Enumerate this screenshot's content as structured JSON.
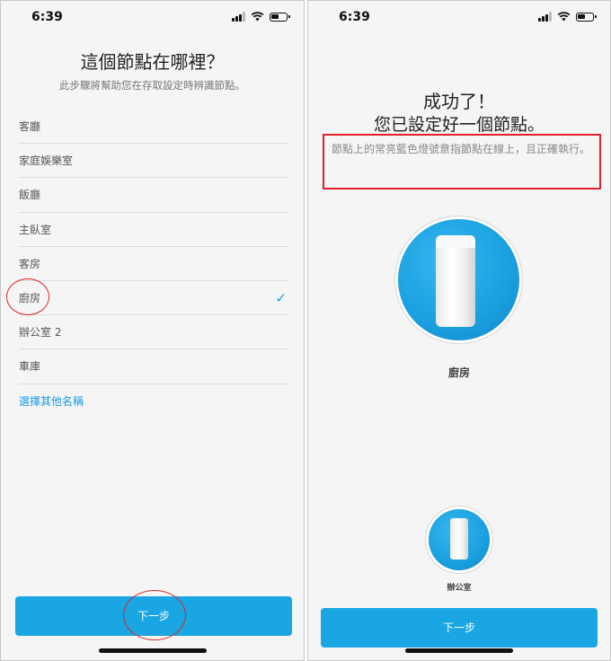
{
  "left_screen": {
    "time": "6:39",
    "title": "這個節點在哪裡？",
    "subtitle": "此步驟將幫助您在存取設定時辨識節點。",
    "rooms": [
      {
        "label": "客廳",
        "selected": false
      },
      {
        "label": "家庭娛樂室",
        "selected": false
      },
      {
        "label": "飯廳",
        "selected": false
      },
      {
        "label": "主臥室",
        "selected": false
      },
      {
        "label": "客房",
        "selected": false
      },
      {
        "label": "廚房",
        "selected": true
      },
      {
        "label": "辦公室 2",
        "selected": false
      },
      {
        "label": "車庫",
        "selected": false
      }
    ],
    "check_icon": "✓",
    "other_name_link": "選擇其他名稱",
    "next_button": "下一步"
  },
  "right_screen": {
    "time": "6:39",
    "title_line1": "成功了！",
    "title_line2": "您已設定好一個節點。",
    "info_text": "節點上的常亮藍色燈號意指節點在線上，且正確執行。",
    "nodes": [
      {
        "label": "廚房",
        "size": "large"
      },
      {
        "label": "辦公室",
        "size": "small"
      }
    ],
    "next_button": "下一步"
  },
  "colors": {
    "accent": "#1aa5e3",
    "link": "#1a9be6",
    "annotation_red": "#e0202a",
    "background": "#f5f5f5"
  },
  "icons": [
    "signal-icon",
    "wifi-icon",
    "battery-icon",
    "checkmark-icon",
    "node-device-icon"
  ]
}
